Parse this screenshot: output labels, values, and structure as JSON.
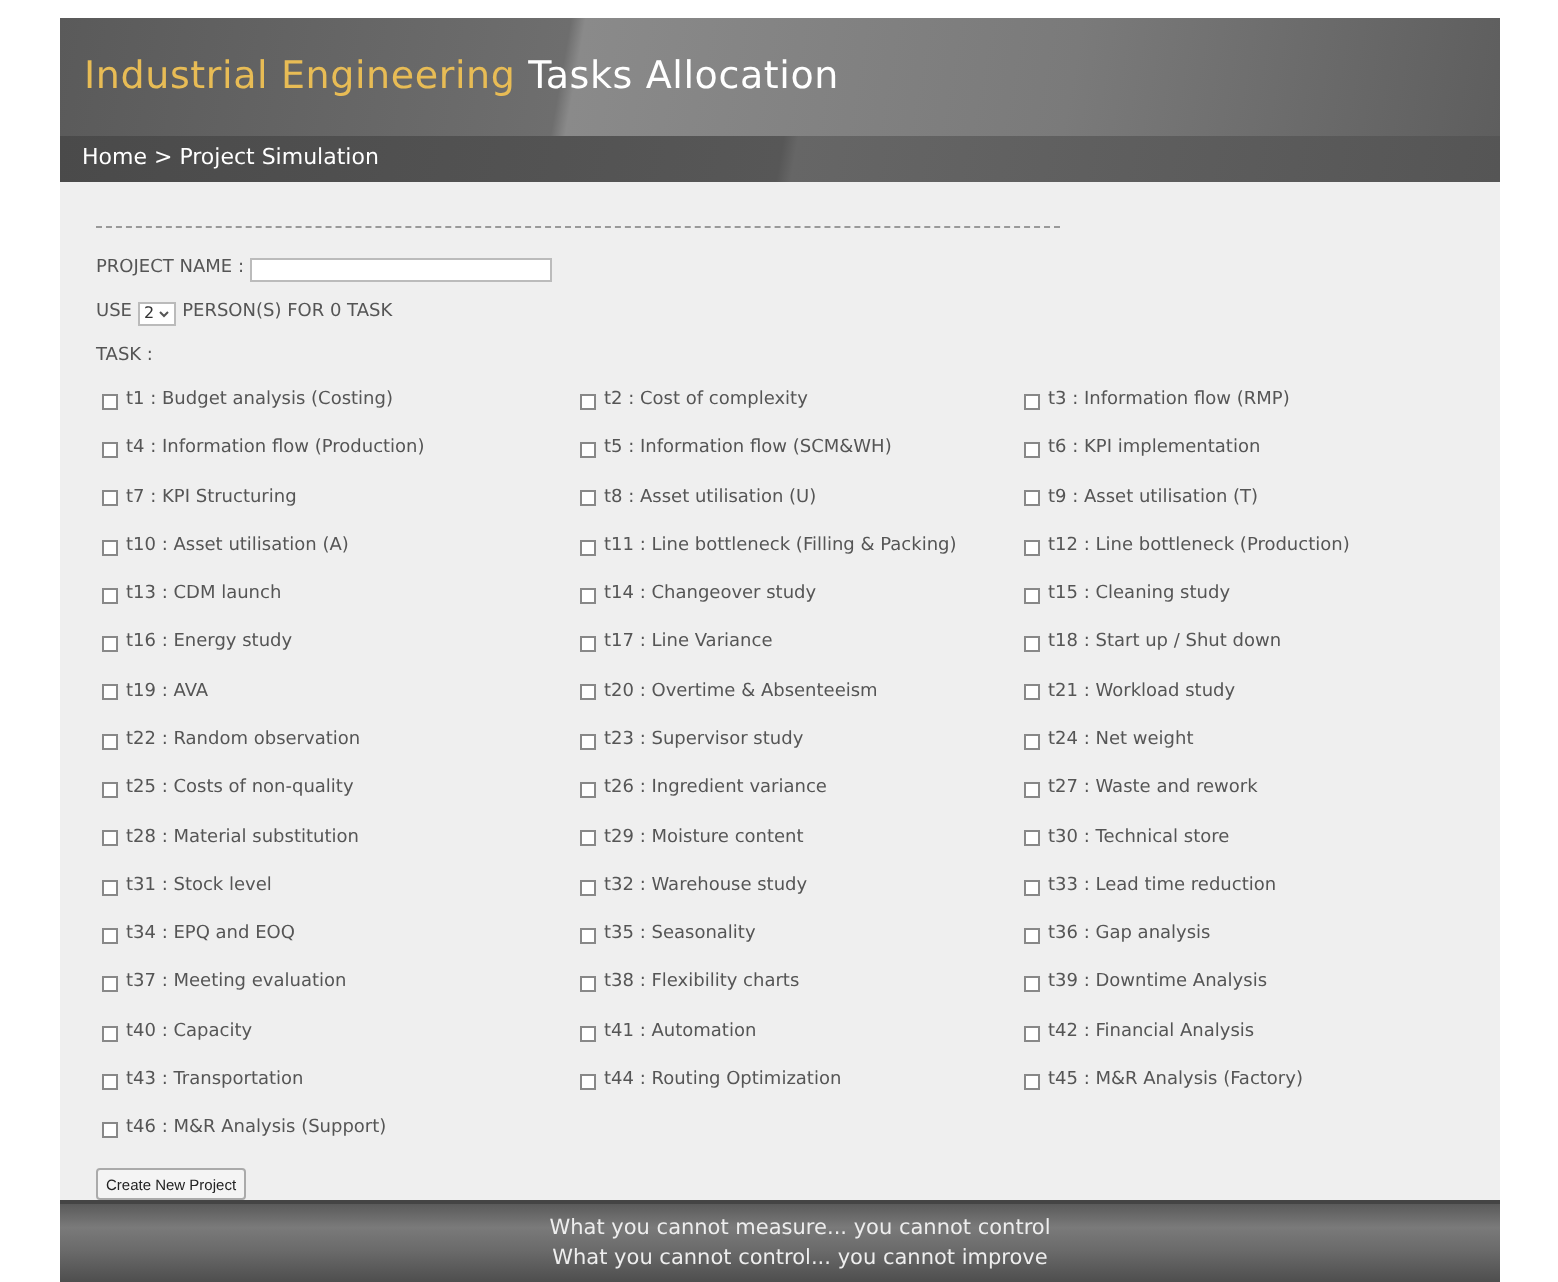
{
  "header": {
    "title_highlight": "Industrial Engineering",
    "title_rest": "Tasks Allocation"
  },
  "breadcrumb": "Home > Project Simulation",
  "form": {
    "project_name_label": "PROJECT NAME :",
    "use_label": "USE",
    "persons_select": {
      "value": "2"
    },
    "persons_label": "PERSON(S) FOR 0 TASK",
    "task_label": "TASK :"
  },
  "tasks": [
    {
      "label": "t1 : Budget analysis (Costing)",
      "checked": false
    },
    {
      "label": "t2 : Cost of complexity",
      "checked": false
    },
    {
      "label": "t3 : Information flow (RMP)",
      "checked": false
    },
    {
      "label": "t4 : Information flow (Production)",
      "checked": false
    },
    {
      "label": "t5 : Information flow (SCM&WH)",
      "checked": false
    },
    {
      "label": "t6 : KPI implementation",
      "checked": false
    },
    {
      "label": "t7 : KPI Structuring",
      "checked": false
    },
    {
      "label": "t8 : Asset utilisation (U)",
      "checked": false
    },
    {
      "label": "t9 : Asset utilisation (T)",
      "checked": false
    },
    {
      "label": "t10 : Asset utilisation (A)",
      "checked": false
    },
    {
      "label": "t11 : Line bottleneck (Filling & Packing)",
      "checked": false
    },
    {
      "label": "t12 : Line bottleneck (Production)",
      "checked": false
    },
    {
      "label": "t13 : CDM launch",
      "checked": false
    },
    {
      "label": "t14 : Changeover study",
      "checked": false
    },
    {
      "label": "t15 : Cleaning study",
      "checked": false
    },
    {
      "label": "t16 : Energy study",
      "checked": false
    },
    {
      "label": "t17 : Line Variance",
      "checked": false
    },
    {
      "label": "t18 : Start up / Shut down",
      "checked": false
    },
    {
      "label": "t19 : AVA",
      "checked": false
    },
    {
      "label": "t20 : Overtime & Absenteeism",
      "checked": false
    },
    {
      "label": "t21 : Workload study",
      "checked": false
    },
    {
      "label": "t22 : Random observation",
      "checked": false
    },
    {
      "label": "t23 : Supervisor study",
      "checked": false
    },
    {
      "label": "t24 : Net weight",
      "checked": false
    },
    {
      "label": "t25 : Costs of non-quality",
      "checked": false
    },
    {
      "label": "t26 : Ingredient variance",
      "checked": false
    },
    {
      "label": "t27 : Waste and rework",
      "checked": false
    },
    {
      "label": "t28 : Material substitution",
      "checked": false
    },
    {
      "label": "t29 : Moisture content",
      "checked": false
    },
    {
      "label": "t30 : Technical store",
      "checked": false
    },
    {
      "label": "t31 : Stock level",
      "checked": false
    },
    {
      "label": "t32 : Warehouse study",
      "checked": false
    },
    {
      "label": "t33 : Lead time reduction",
      "checked": false
    },
    {
      "label": "t34 : EPQ and EOQ",
      "checked": false
    },
    {
      "label": "t35 : Seasonality",
      "checked": false
    },
    {
      "label": "t36 : Gap analysis",
      "checked": false
    },
    {
      "label": "t37 : Meeting evaluation",
      "checked": false
    },
    {
      "label": "t38 : Flexibility charts",
      "checked": false
    },
    {
      "label": "t39 : Downtime Analysis",
      "checked": false
    },
    {
      "label": "t40 : Capacity",
      "checked": false
    },
    {
      "label": "t41 : Automation",
      "checked": false
    },
    {
      "label": "t42 : Financial Analysis",
      "checked": false
    },
    {
      "label": "t43 : Transportation",
      "checked": false
    },
    {
      "label": "t44 : Routing Optimization",
      "checked": false
    },
    {
      "label": "t45 : M&R Analysis (Factory)",
      "checked": false
    },
    {
      "label": "t46 : M&R Analysis (Support)",
      "checked": false
    }
  ],
  "create_button": "Create New Project",
  "footer": [
    "What you cannot measure... you cannot control",
    "What you cannot control... you cannot improve"
  ]
}
